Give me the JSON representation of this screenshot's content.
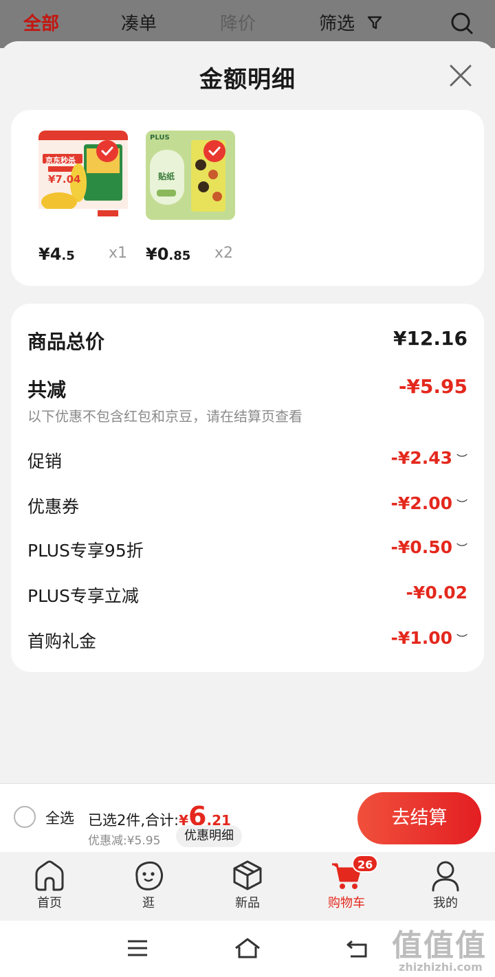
{
  "top_tabs": [
    {
      "label": "全部"
    },
    {
      "label": "凑单"
    },
    {
      "label": "降价"
    },
    {
      "label": "筛选"
    }
  ],
  "sheet": {
    "title": "金额明细"
  },
  "products": [
    {
      "thumb_text_1": "京东秒杀",
      "thumb_price": "¥7.04",
      "price_int": "¥4",
      "price_dec": ".5",
      "qty": "x1",
      "checked": true
    },
    {
      "thumb_text_1": "PLUS",
      "thumb_text_2": "贴纸",
      "price_int": "¥0",
      "price_dec": ".85",
      "qty": "x2",
      "checked": true
    }
  ],
  "detail": {
    "total_label": "商品总价",
    "total_value": "¥12.16",
    "reduce_label": "共减",
    "reduce_value": "-¥5.95",
    "note": "以下优惠不包含红包和京豆，请在结算页查看",
    "items": [
      {
        "label": "促销",
        "value": "-¥2.43",
        "expandable": true
      },
      {
        "label": "优惠券",
        "value": "-¥2.00",
        "expandable": true
      },
      {
        "label": "PLUS专享95折",
        "value": "-¥0.50",
        "expandable": true
      },
      {
        "label": "PLUS专享立减",
        "value": "-¥0.02",
        "expandable": false
      },
      {
        "label": "首购礼金",
        "value": "-¥1.00",
        "expandable": true
      }
    ]
  },
  "settle": {
    "select_all": "全选",
    "summary_prefix": "已选2件,合计:",
    "currency": "¥",
    "total_int": "6",
    "total_dec": ".21",
    "saved": "优惠减:¥5.95",
    "detail_chip": "优惠明细",
    "checkout": "去结算"
  },
  "bottom_nav": [
    {
      "label": "首页",
      "icon": "home-icon"
    },
    {
      "label": "逛",
      "icon": "face-icon"
    },
    {
      "label": "新品",
      "icon": "cube-icon"
    },
    {
      "label": "购物车",
      "icon": "cart-icon",
      "badge": "26",
      "active": true
    },
    {
      "label": "我的",
      "icon": "person-icon"
    }
  ],
  "watermark": {
    "glyphs": "值值值",
    "text": "zhizhizhi.com"
  },
  "colors": {
    "accent": "#e4281d",
    "checkout_gradient_start": "#f0503c",
    "checkout_gradient_end": "#e31e22"
  }
}
